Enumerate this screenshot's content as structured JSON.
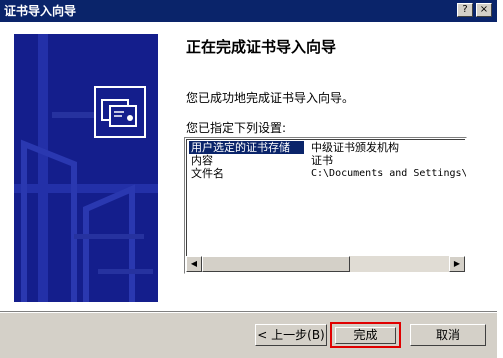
{
  "window": {
    "title": "证书导入向导",
    "help_glyph": "?",
    "close_glyph": "×"
  },
  "main": {
    "heading": "正在完成证书导入向导",
    "success_message": "您已成功地完成证书导入向导。",
    "settings_label": "您已指定下列设置:"
  },
  "settings_table": {
    "rows": [
      {
        "name": "用户选定的证书存储",
        "value": "中级证书颁发机构",
        "selected": true
      },
      {
        "name": "内容",
        "value": "证书",
        "selected": false
      },
      {
        "name": "文件名",
        "value": "C:\\Documents and Settings\\",
        "selected": false
      }
    ],
    "scroll_left_glyph": "◀",
    "scroll_right_glyph": "▶"
  },
  "buttons": {
    "back": "< 上一步(B)",
    "finish": "完成",
    "cancel": "取消"
  },
  "colors": {
    "title_bar": "#0a246a",
    "side_panel": "#141e8c",
    "highlight_frame": "#e00000"
  },
  "icons": {
    "side_panel_icon": "certificate-icon"
  }
}
